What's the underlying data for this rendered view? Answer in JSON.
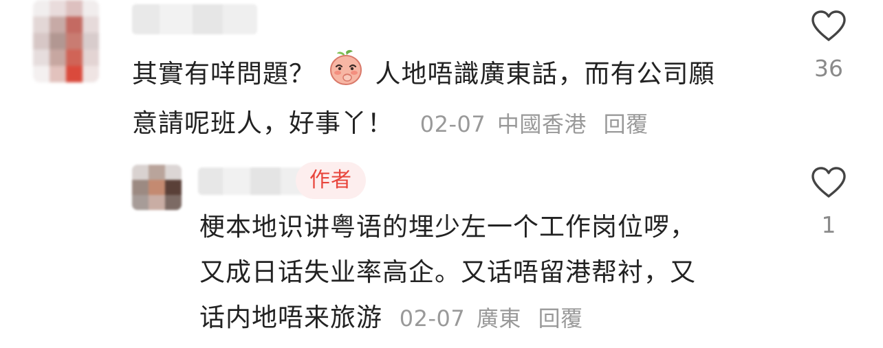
{
  "comments": [
    {
      "text_part1": "其實有咩問題？",
      "emoji": "shy-peach-emoji",
      "text_part2": "人地唔識廣東話，而有公司願",
      "text_line2": "意請呢班人，好事丫！",
      "date": "02-07",
      "location": "中國香港",
      "reply_label": "回覆",
      "likes": "36"
    }
  ],
  "replies": [
    {
      "badge": "作者",
      "text_line1": "梗本地识讲粤语的埋少左一个工作岗位啰，",
      "text_line2": "又成日话失业率高企。又话唔留港帮衬，又",
      "text_line3": "话内地唔来旅游",
      "date": "02-07",
      "location": "廣東",
      "reply_label": "回覆",
      "likes": "1"
    }
  ],
  "colors": {
    "text": "#222222",
    "meta": "#999999",
    "badge_bg": "#fdeeee",
    "badge_text": "#e8453c"
  },
  "icons": {
    "like": "heart-outline-icon"
  }
}
